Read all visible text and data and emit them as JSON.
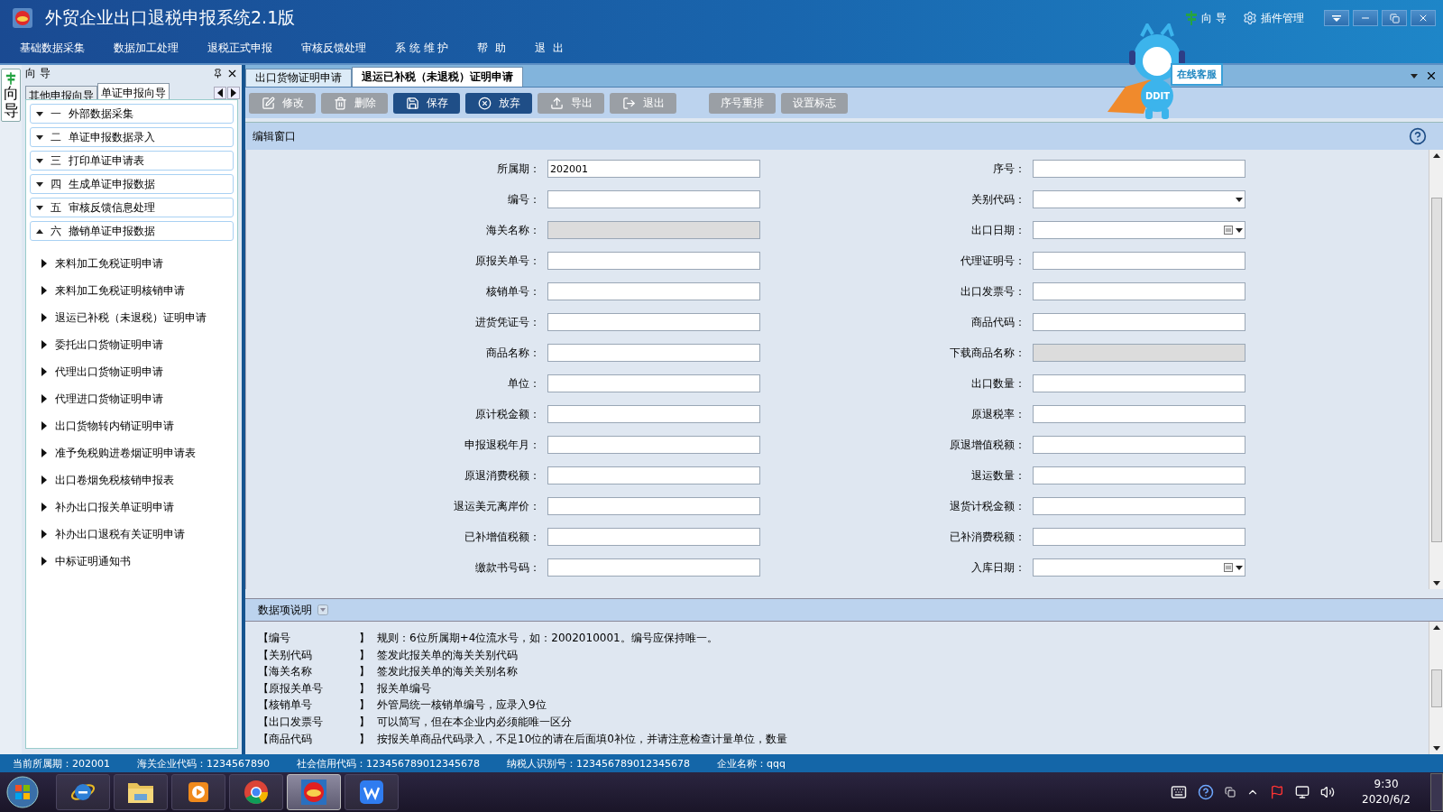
{
  "app": {
    "title": "外贸企业出口退税申报系统2.1版",
    "guide": "向 导",
    "plugins": "插件管理"
  },
  "menu": [
    "基础数据采集",
    "数据加工处理",
    "退税正式申报",
    "审核反馈处理",
    "系 统 维 护",
    "帮  助",
    "退  出"
  ],
  "mascot": {
    "badge": "DDIT",
    "sign": "在线客服"
  },
  "side_tab": "向导",
  "guide_panel": {
    "title": "向 导",
    "tabs": [
      {
        "label": "其他申报向导",
        "selected": false
      },
      {
        "label": "单证申报向导",
        "selected": true
      }
    ],
    "sections": [
      {
        "label": "一  外部数据采集",
        "expanded": false
      },
      {
        "label": "二  单证申报数据录入",
        "expanded": false
      },
      {
        "label": "三  打印单证申请表",
        "expanded": false
      },
      {
        "label": "四  生成单证申报数据",
        "expanded": false
      },
      {
        "label": "五  审核反馈信息处理",
        "expanded": false
      },
      {
        "label": "六  撤销单证申报数据",
        "expanded": true,
        "children": [
          {
            "label": "来料加工免税证明申请"
          },
          {
            "label": "来料加工免税证明核销申请"
          },
          {
            "label": "退运已补税（未退税）证明申请"
          },
          {
            "label": "委托出口货物证明申请"
          },
          {
            "label": "代理出口货物证明申请"
          },
          {
            "label": "代理进口货物证明申请"
          },
          {
            "label": "出口货物转内销证明申请"
          },
          {
            "label": "准予免税购进卷烟证明申请表"
          },
          {
            "label": "出口卷烟免税核销申报表"
          },
          {
            "label": "补办出口报关单证明申请"
          },
          {
            "label": "补办出口退税有关证明申请"
          },
          {
            "label": "中标证明通知书"
          }
        ]
      }
    ]
  },
  "doc_tabs": [
    {
      "label": "出口货物证明申请",
      "selected": false
    },
    {
      "label": "退运已补税（未退税）证明申请",
      "selected": true
    }
  ],
  "toolbar": [
    {
      "label": "修改",
      "kind": "edit",
      "disabled": true
    },
    {
      "label": "删除",
      "kind": "delete",
      "disabled": true
    },
    {
      "label": "保存",
      "kind": "save",
      "disabled": false
    },
    {
      "label": "放弃",
      "kind": "cancel",
      "disabled": false
    },
    {
      "label": "导出",
      "kind": "export",
      "disabled": true
    },
    {
      "label": "退出",
      "kind": "exit",
      "disabled": true
    },
    {
      "label": "序号重排",
      "kind": "plain",
      "disabled": true
    },
    {
      "label": "设置标志",
      "kind": "plain",
      "disabled": true
    }
  ],
  "editor": {
    "title": "编辑窗口",
    "fields": [
      {
        "label": "所属期：",
        "kind": "text",
        "value": "202001"
      },
      {
        "label": "序号：",
        "kind": "text"
      },
      {
        "label": "编号：",
        "kind": "text"
      },
      {
        "label": "关别代码：",
        "kind": "select"
      },
      {
        "label": "海关名称：",
        "kind": "readonly"
      },
      {
        "label": "出口日期：",
        "kind": "date"
      },
      {
        "label": "原报关单号：",
        "kind": "text"
      },
      {
        "label": "代理证明号：",
        "kind": "text"
      },
      {
        "label": "核销单号：",
        "kind": "text"
      },
      {
        "label": "出口发票号：",
        "kind": "text"
      },
      {
        "label": "进货凭证号：",
        "kind": "text"
      },
      {
        "label": "商品代码：",
        "kind": "text"
      },
      {
        "label": "商品名称：",
        "kind": "text"
      },
      {
        "label": "下载商品名称：",
        "kind": "readonly"
      },
      {
        "label": "单位：",
        "kind": "text"
      },
      {
        "label": "出口数量：",
        "kind": "text"
      },
      {
        "label": "原计税金额：",
        "kind": "text"
      },
      {
        "label": "原退税率：",
        "kind": "text"
      },
      {
        "label": "申报退税年月：",
        "kind": "text"
      },
      {
        "label": "原退增值税额：",
        "kind": "text"
      },
      {
        "label": "原退消费税额：",
        "kind": "text"
      },
      {
        "label": "退运数量：",
        "kind": "text"
      },
      {
        "label": "退运美元离岸价：",
        "kind": "text"
      },
      {
        "label": "退货计税金额：",
        "kind": "text"
      },
      {
        "label": "已补增值税额：",
        "kind": "text"
      },
      {
        "label": "已补消费税额：",
        "kind": "text"
      },
      {
        "label": "缴款书号码：",
        "kind": "text"
      },
      {
        "label": "入库日期：",
        "kind": "date"
      }
    ]
  },
  "notes": {
    "title": "数据项说明",
    "items": [
      {
        "term": "【编号",
        "close": "】",
        "text": "规则：6位所属期+4位流水号，如：2002010001。编号应保持唯一。"
      },
      {
        "term": "【关别代码",
        "close": "】",
        "text": "签发此报关单的海关关别代码"
      },
      {
        "term": "【海关名称",
        "close": "】",
        "text": "签发此报关单的海关关别名称"
      },
      {
        "term": "【原报关单号",
        "close": "】",
        "text": "报关单编号"
      },
      {
        "term": "【核销单号",
        "close": "】",
        "text": "外管局统一核销单编号，应录入9位"
      },
      {
        "term": "【出口发票号",
        "close": "】",
        "text": "可以简写，但在本企业内必须能唯一区分"
      },
      {
        "term": "【商品代码",
        "close": "】",
        "text": "按报关单商品代码录入，不足10位的请在后面填0补位，并请注意检查计量单位，数量"
      }
    ]
  },
  "status_bar": [
    "当前所属期：202001",
    "海关企业代码：1234567890",
    "社会信用代码：123456789012345678",
    "纳税人识别号：123456789012345678",
    "企业名称：qqq"
  ],
  "taskbar": {
    "apps": [
      {
        "kind": "browser",
        "selected": false
      },
      {
        "kind": "folder",
        "selected": false
      },
      {
        "kind": "media",
        "selected": false
      },
      {
        "kind": "chrome",
        "selected": false
      },
      {
        "kind": "tax",
        "selected": true
      },
      {
        "kind": "wps",
        "selected": false
      }
    ],
    "time": "9:30",
    "date": "2020/6/2"
  }
}
